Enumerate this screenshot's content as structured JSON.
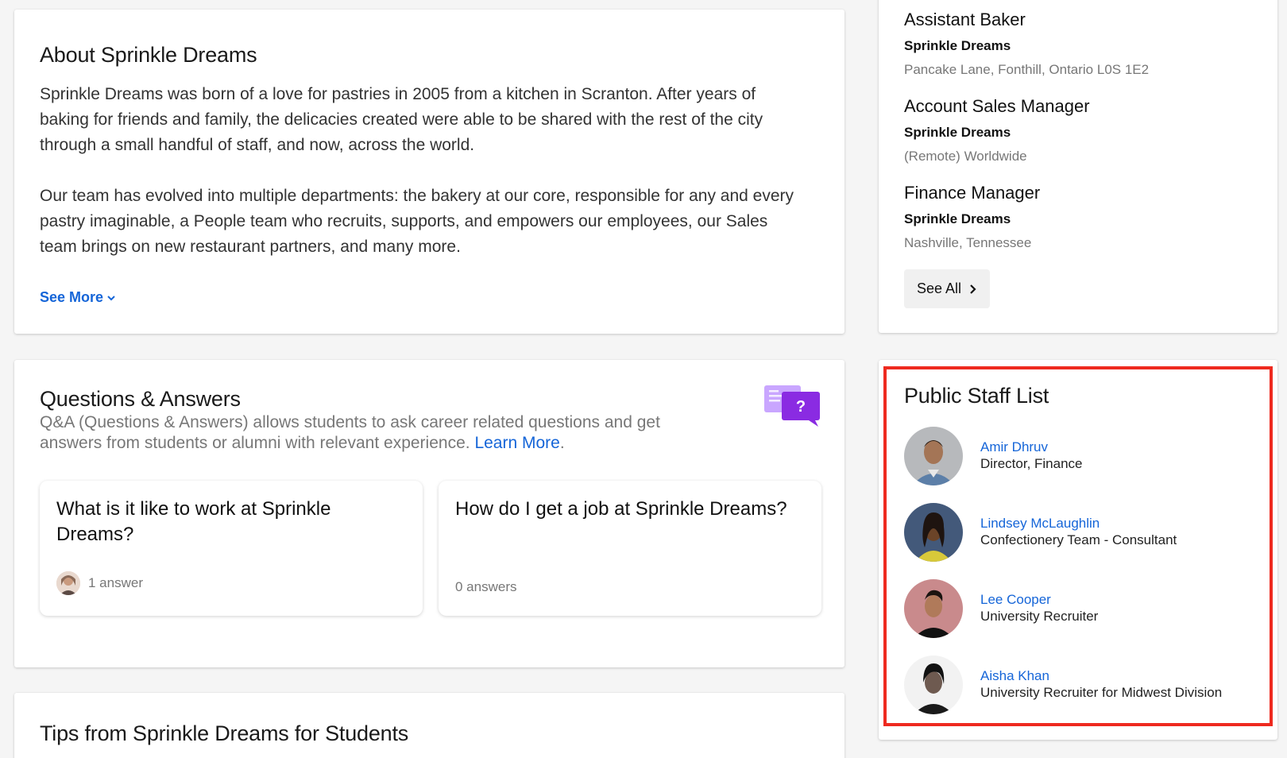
{
  "about": {
    "title": "About Sprinkle Dreams",
    "paragraph1": "Sprinkle Dreams was born of a love for pastries in 2005 from a kitchen in Scranton. After years of baking for friends and family, the delicacies created were able to be shared with the rest of the city through a small handful of staff, and now, across the world.",
    "paragraph2": "Our team has evolved into multiple departments: the bakery at our core, responsible for any and every pastry imaginable, a People team who recruits, supports, and empowers our employees, our Sales team brings on new restaurant partners, and many more.",
    "see_more": "See More"
  },
  "qa": {
    "title": "Questions & Answers",
    "description": "Q&A (Questions & Answers) allows students to ask career related questions and get answers from students or alumni with relevant experience.",
    "learn_more": "Learn More",
    "learn_more_suffix": ".",
    "questions": [
      {
        "text": "What is it like to work at Sprinkle Dreams?",
        "answers": "1 answer"
      },
      {
        "text": "How do I get a job at Sprinkle Dreams?",
        "answers": "0 answers"
      }
    ]
  },
  "tips": {
    "title": "Tips from Sprinkle Dreams for Students"
  },
  "jobs": {
    "items": [
      {
        "title": "Assistant Baker",
        "company": "Sprinkle Dreams",
        "location": "Pancake Lane, Fonthill, Ontario L0S 1E2"
      },
      {
        "title": "Account Sales Manager",
        "company": "Sprinkle Dreams",
        "location": "(Remote) Worldwide"
      },
      {
        "title": "Finance Manager",
        "company": "Sprinkle Dreams",
        "location": "Nashville, Tennessee"
      }
    ],
    "see_all": "See All"
  },
  "staff": {
    "title": "Public Staff List",
    "people": [
      {
        "name": "Amir Dhruv",
        "role": "Director, Finance"
      },
      {
        "name": "Lindsey McLaughlin",
        "role": "Confectionery Team - Consultant"
      },
      {
        "name": "Lee Cooper",
        "role": "University Recruiter"
      },
      {
        "name": "Aisha Khan",
        "role": "University Recruiter for Midwest Division"
      }
    ]
  },
  "colors": {
    "link": "#1565d8",
    "highlight": "#ee2a1f",
    "qa_icon": "#8a2be2"
  }
}
